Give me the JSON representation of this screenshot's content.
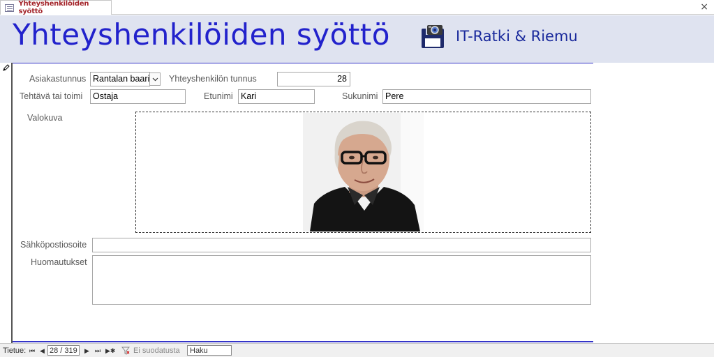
{
  "tab": {
    "title": "Yhteyshenkilöiden syöttö",
    "close_glyph": "×"
  },
  "header": {
    "title": "Yhteyshenkilöiden syöttö",
    "brand_icon": "floppy-camera-icon",
    "brand_name": "IT-Ratki & Riemu",
    "colors": {
      "band": "#dfe3f0",
      "title": "#2222cc",
      "rule": "#3434c8"
    }
  },
  "form": {
    "customer_id": {
      "label": "Asiakastunnus",
      "value": "Rantalan baari"
    },
    "contact_id": {
      "label": "Yhteyshenkilön tunnus",
      "value": "28"
    },
    "role": {
      "label": "Tehtävä tai toimi",
      "value": "Ostaja"
    },
    "first_name": {
      "label": "Etunimi",
      "value": "Kari"
    },
    "last_name": {
      "label": "Sukunimi",
      "value": "Pere"
    },
    "photo": {
      "label": "Valokuva"
    },
    "email": {
      "label": "Sähköpostiosoite",
      "value": ""
    },
    "notes": {
      "label": "Huomautukset",
      "value": ""
    }
  },
  "statusbar": {
    "record_label": "Tietue:",
    "record_value": "28 / 319",
    "filter_label": "Ei suodatusta",
    "search_label": "Haku",
    "nav_first": "⏮",
    "nav_prev": "◀",
    "nav_next": "▶",
    "nav_last": "⏭",
    "nav_new": "▶✱"
  }
}
